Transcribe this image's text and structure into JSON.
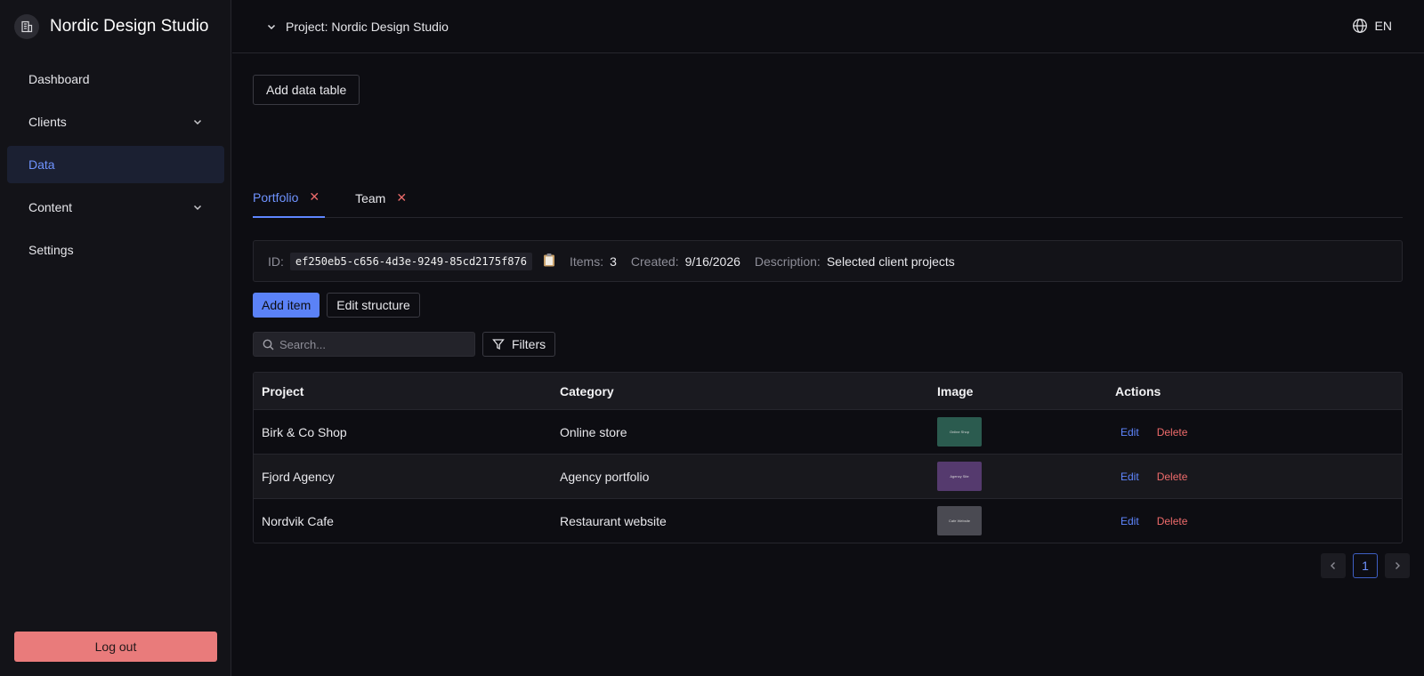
{
  "app": {
    "name": "Nordic Design Studio"
  },
  "sidebar": {
    "items": [
      {
        "label": "Dashboard",
        "expandable": false,
        "active": false
      },
      {
        "label": "Clients",
        "expandable": true,
        "active": false
      },
      {
        "label": "Data",
        "expandable": false,
        "active": true
      },
      {
        "label": "Content",
        "expandable": true,
        "active": false
      },
      {
        "label": "Settings",
        "expandable": false,
        "active": false
      }
    ],
    "logout_label": "Log out"
  },
  "header": {
    "project_label": "Project: Nordic Design Studio",
    "language": "EN"
  },
  "main": {
    "add_table_label": "Add data table",
    "tabs": [
      {
        "label": "Portfolio",
        "active": true,
        "close": "✕"
      },
      {
        "label": "Team",
        "active": false,
        "close": "✕"
      }
    ],
    "info": {
      "id_label": "ID:",
      "id_value": "ef250eb5-c656-4d3e-9249-85cd2175f876",
      "items_label": "Items:",
      "items_value": "3",
      "created_label": "Created:",
      "created_value": "9/16/2026",
      "description_label": "Description:",
      "description_value": "Selected client projects"
    },
    "add_item_label": "Add item",
    "edit_structure_label": "Edit structure",
    "search_placeholder": "Search...",
    "filters_label": "Filters",
    "table": {
      "headers": [
        "Project",
        "Category",
        "Image",
        "Actions"
      ],
      "rows": [
        {
          "project": "Birk & Co Shop",
          "category": "Online store",
          "thumb_text": "Online Shop",
          "thumb_color": "#2b5b4f",
          "edit": "Edit",
          "delete": "Delete"
        },
        {
          "project": "Fjord Agency",
          "category": "Agency portfolio",
          "thumb_text": "Agency Site",
          "thumb_color": "#553a6e",
          "edit": "Edit",
          "delete": "Delete"
        },
        {
          "project": "Nordvik Cafe",
          "category": "Restaurant website",
          "thumb_text": "Cafe Website",
          "thumb_color": "#4a4a52",
          "edit": "Edit",
          "delete": "Delete"
        }
      ]
    },
    "pagination": {
      "current": "1"
    }
  },
  "colors": {
    "accent": "#5b82f7",
    "danger": "#ef6b6b",
    "background": "#0d0d12",
    "sidebar": "#131318"
  }
}
